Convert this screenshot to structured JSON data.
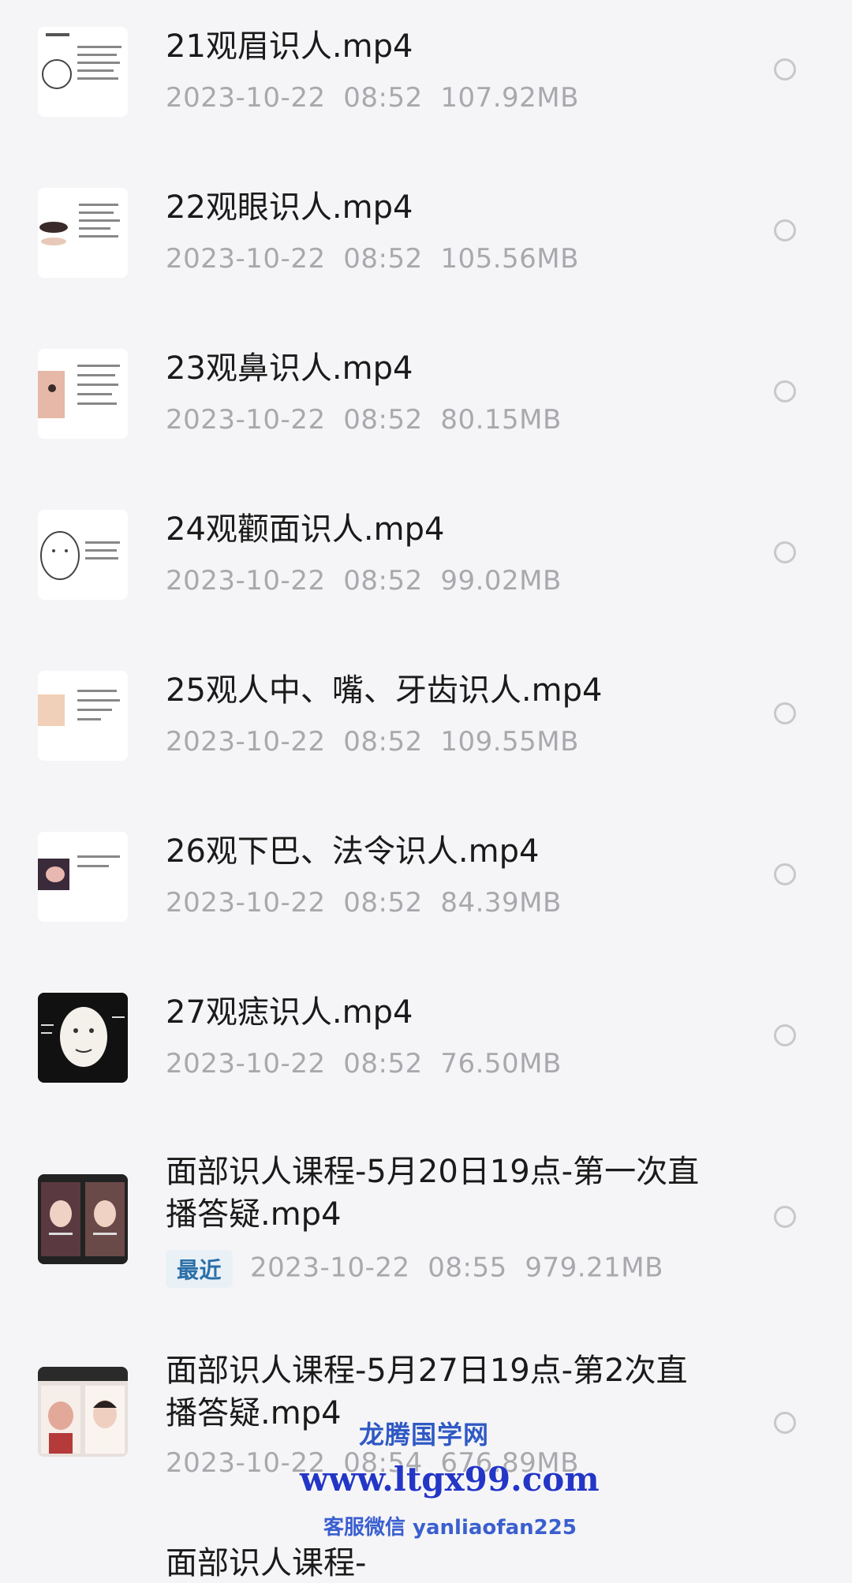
{
  "files": [
    {
      "title": "21观眉识人.mp4",
      "date": "2023-10-22",
      "time": "08:52",
      "size": "107.92MB",
      "badge": ""
    },
    {
      "title": "22观眼识人.mp4",
      "date": "2023-10-22",
      "time": "08:52",
      "size": "105.56MB",
      "badge": ""
    },
    {
      "title": "23观鼻识人.mp4",
      "date": "2023-10-22",
      "time": "08:52",
      "size": "80.15MB",
      "badge": ""
    },
    {
      "title": "24观颧面识人.mp4",
      "date": "2023-10-22",
      "time": "08:52",
      "size": "99.02MB",
      "badge": ""
    },
    {
      "title": "25观人中、嘴、牙齿识人.mp4",
      "date": "2023-10-22",
      "time": "08:52",
      "size": "109.55MB",
      "badge": ""
    },
    {
      "title": "26观下巴、法令识人.mp4",
      "date": "2023-10-22",
      "time": "08:52",
      "size": "84.39MB",
      "badge": ""
    },
    {
      "title": "27观痣识人.mp4",
      "date": "2023-10-22",
      "time": "08:52",
      "size": "76.50MB",
      "badge": ""
    },
    {
      "title": "面部识人课程-5月20日19点-第一次直播答疑.mp4",
      "date": "2023-10-22",
      "time": "08:55",
      "size": "979.21MB",
      "badge": "最近"
    },
    {
      "title": "面部识人课程-5月27日19点-第2次直播答疑.mp4",
      "date": "2023-10-22",
      "time": "08:54",
      "size": "676.89MB",
      "badge": ""
    }
  ],
  "partial_title": "面部识人课程-",
  "watermark": {
    "site_name": "龙腾国学网",
    "url": "www.ltgx99.com",
    "wechat": "客服微信 yanliaofan225"
  },
  "colors": {
    "background": "#f5f5f7",
    "title": "#1a1a1a",
    "meta": "#a9a9ad",
    "badge": "#2a6fa8"
  },
  "icons": [
    "thumbnail-image",
    "radio-unchecked-icon"
  ]
}
